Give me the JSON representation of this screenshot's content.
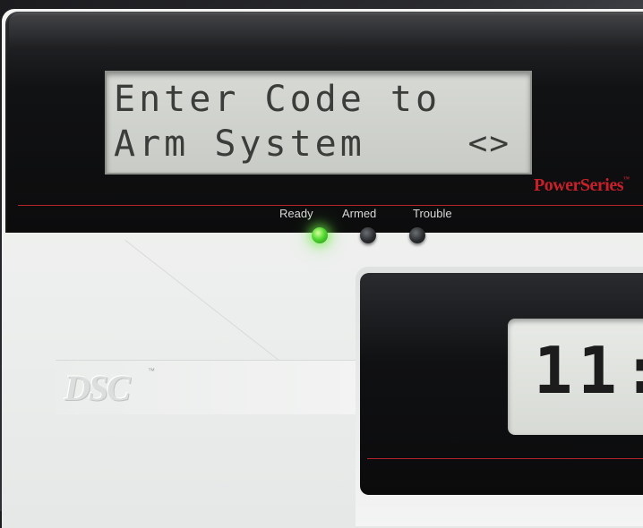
{
  "keypad": {
    "lcd_line1": "Enter Code to",
    "lcd_line2": "Arm System",
    "scroll_arrows": "<>",
    "brand": "PowerSeries",
    "brand_tm": "™",
    "indicators": [
      {
        "label": "Ready",
        "state": "on",
        "color": "#53d933"
      },
      {
        "label": "Armed",
        "state": "off"
      },
      {
        "label": "Trouble",
        "state": "off"
      }
    ],
    "logo": "DSC",
    "logo_tm": "™"
  },
  "clock_display": {
    "digits": "11:"
  },
  "colors": {
    "accent_red": "#c8202a",
    "bezel": "#111214",
    "lcd_background": "#d6d9d4",
    "ready_led": "#53d933"
  }
}
